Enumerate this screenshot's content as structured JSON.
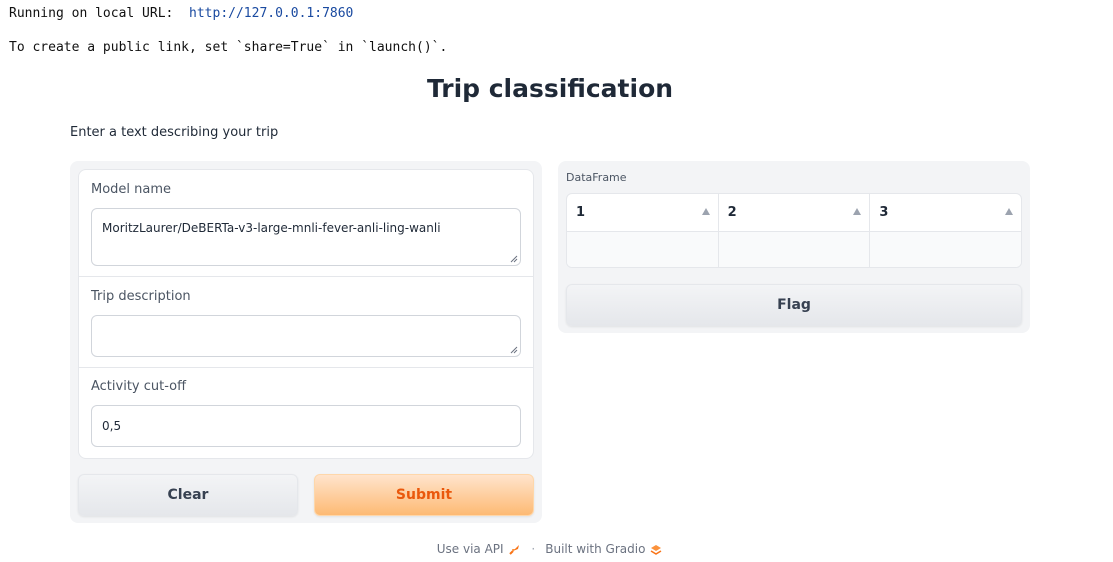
{
  "console": {
    "line1_prefix": "Running on local URL:  ",
    "url": "http://127.0.0.1:7860",
    "line2": "To create a public link, set `share=True` in `launch()`."
  },
  "header": {
    "title": "Trip classification",
    "description": "Enter a text describing your trip"
  },
  "form": {
    "model_name": {
      "label": "Model name",
      "value": "MoritzLaurer/DeBERTa-v3-large-mnli-fever-anli-ling-wanli"
    },
    "trip_description": {
      "label": "Trip description",
      "value": ""
    },
    "activity_cutoff": {
      "label": "Activity cut-off",
      "value": "0,5"
    }
  },
  "buttons": {
    "clear": "Clear",
    "submit": "Submit",
    "flag": "Flag"
  },
  "dataframe": {
    "label": "DataFrame",
    "headers": [
      "1",
      "2",
      "3"
    ],
    "rows": [
      [
        "",
        "",
        ""
      ]
    ]
  },
  "footer": {
    "api": "Use via API",
    "separator": "·",
    "built": "Built with Gradio"
  },
  "colors": {
    "accent": "#ea580c",
    "link": "#1a4aa0"
  }
}
